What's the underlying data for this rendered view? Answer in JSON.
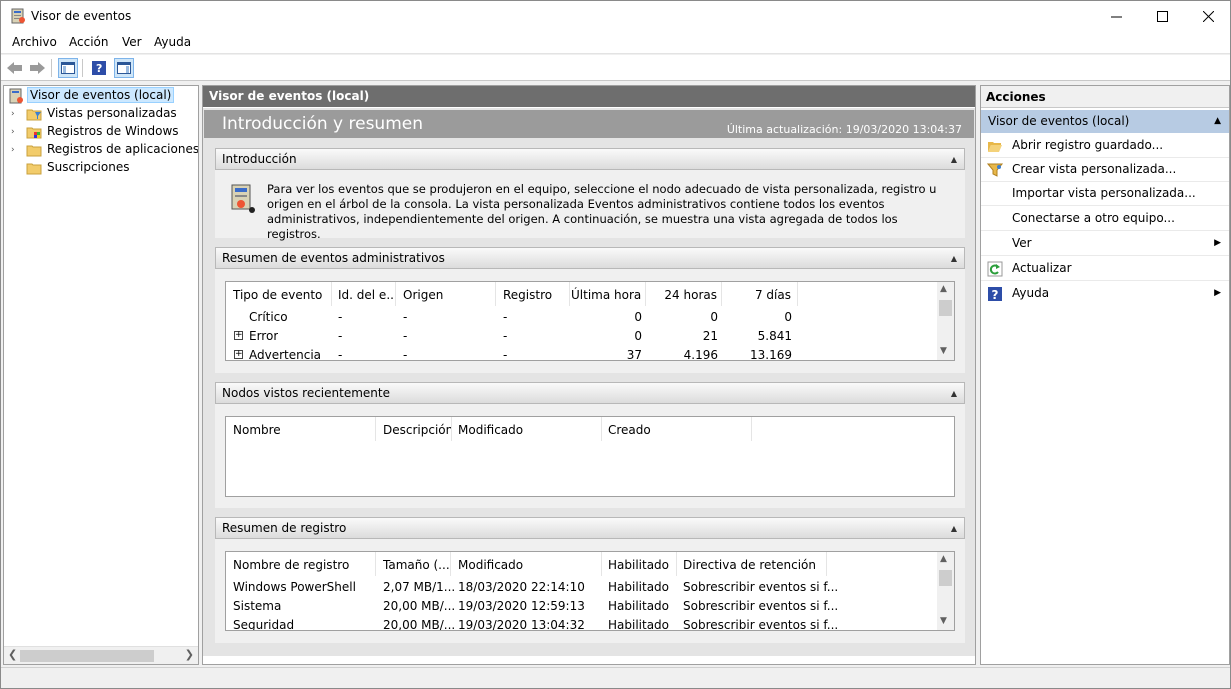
{
  "window": {
    "title": "Visor de eventos"
  },
  "menu": [
    "Archivo",
    "Acción",
    "Ver",
    "Ayuda"
  ],
  "tree": {
    "root": "Visor de eventos (local)",
    "items": [
      "Vistas personalizadas",
      "Registros de Windows",
      "Registros de aplicaciones y s",
      "Suscripciones"
    ]
  },
  "center": {
    "header": "Visor de eventos (local)",
    "banner_title": "Introducción y resumen",
    "last_update": "Última actualización: 19/03/2020 13:04:37",
    "intro": {
      "title": "Introducción",
      "text": "Para ver los eventos que se produjeron en el equipo, seleccione el nodo adecuado de vista personalizada, registro u origen en el árbol de la consola. La vista personalizada Eventos administrativos contiene todos los eventos administrativos, independientemente del origen. A continuación, se muestra una vista agregada de todos los registros."
    },
    "admin": {
      "title": "Resumen de eventos administrativos",
      "columns": [
        "Tipo de evento",
        "Id. del e...",
        "Origen",
        "Registro",
        "Última hora",
        "24 horas",
        "7 días"
      ],
      "rows": [
        {
          "type": "Crítico",
          "id": "-",
          "origin": "-",
          "log": "-",
          "hour": "0",
          "day": "0",
          "week": "0",
          "expand": false
        },
        {
          "type": "Error",
          "id": "-",
          "origin": "-",
          "log": "-",
          "hour": "0",
          "day": "21",
          "week": "5.841",
          "expand": true
        },
        {
          "type": "Advertencia",
          "id": "-",
          "origin": "-",
          "log": "-",
          "hour": "37",
          "day": "4.196",
          "week": "13.169",
          "expand": true
        }
      ]
    },
    "recent": {
      "title": "Nodos vistos recientemente",
      "columns": [
        "Nombre",
        "Descripción",
        "Modificado",
        "Creado"
      ]
    },
    "logs": {
      "title": "Resumen de registro",
      "columns": [
        "Nombre de registro",
        "Tamaño (...",
        "Modificado",
        "Habilitado",
        "Directiva de retención"
      ],
      "rows": [
        {
          "name": "Windows PowerShell",
          "size": "2,07 MB/1...",
          "modified": "18/03/2020 22:14:10",
          "enabled": "Habilitado",
          "policy": "Sobrescribir eventos si f..."
        },
        {
          "name": "Sistema",
          "size": "20,00 MB/...",
          "modified": "19/03/2020 12:59:13",
          "enabled": "Habilitado",
          "policy": "Sobrescribir eventos si f..."
        },
        {
          "name": "Seguridad",
          "size": "20,00 MB/...",
          "modified": "19/03/2020 13:04:32",
          "enabled": "Habilitado",
          "policy": "Sobrescribir eventos si f..."
        }
      ]
    }
  },
  "actions": {
    "header": "Acciones",
    "section": "Visor de eventos (local)",
    "items": [
      "Abrir registro guardado...",
      "Crear vista personalizada...",
      "Importar vista personalizada...",
      "Conectarse a otro equipo...",
      "Ver",
      "Actualizar",
      "Ayuda"
    ]
  }
}
